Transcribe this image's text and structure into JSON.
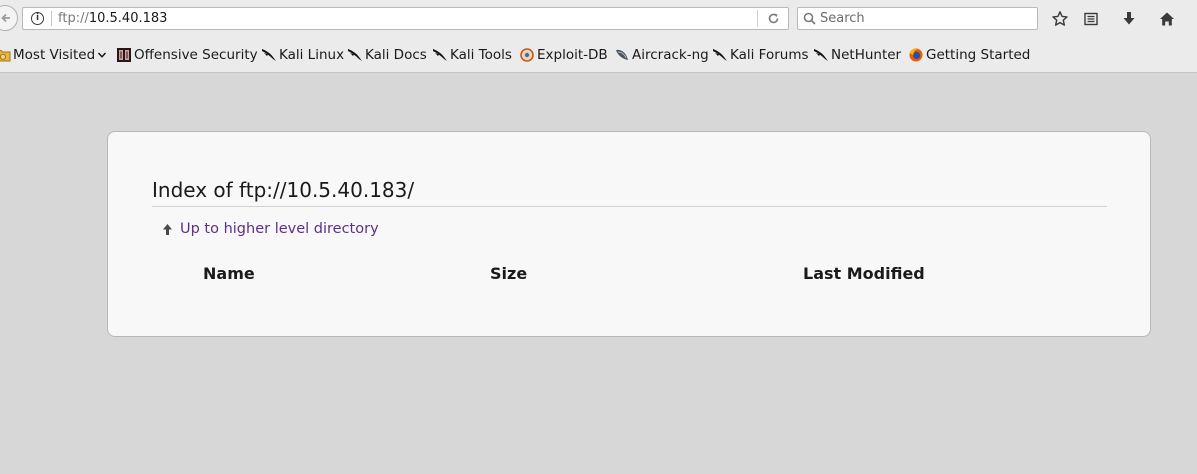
{
  "nav": {
    "url_scheme": "ftp://",
    "url_host": "10.5.40.183",
    "search_placeholder": "Search"
  },
  "bookmarks": [
    {
      "label": "Most Visited",
      "icon": "folder-icon"
    },
    {
      "label": "Offensive Security",
      "icon": "offsec-icon"
    },
    {
      "label": "Kali Linux",
      "icon": "kali-dragon-icon"
    },
    {
      "label": "Kali Docs",
      "icon": "kali-dragon-icon"
    },
    {
      "label": "Kali Tools",
      "icon": "kali-dragon-icon"
    },
    {
      "label": "Exploit-DB",
      "icon": "exploit-db-icon"
    },
    {
      "label": "Aircrack-ng",
      "icon": "aircrack-icon"
    },
    {
      "label": "Kali Forums",
      "icon": "kali-dragon-icon"
    },
    {
      "label": "NetHunter",
      "icon": "kali-dragon-icon"
    },
    {
      "label": "Getting Started",
      "icon": "firefox-icon"
    }
  ],
  "listing": {
    "title": "Index of ftp://10.5.40.183/",
    "up_link": "Up to higher level directory",
    "columns": [
      "Name",
      "Size",
      "Last Modified"
    ]
  },
  "colors": {
    "link_visited": "#5f2f86",
    "page_background": "#d7d7d7",
    "card_background": "#f8f8f8"
  }
}
